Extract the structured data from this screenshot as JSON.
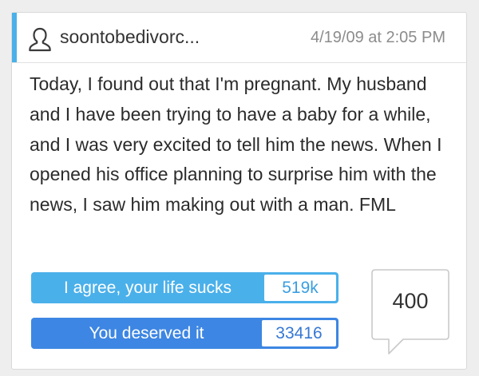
{
  "post": {
    "username": "soontobedivorc...",
    "timestamp": "4/19/09 at 2:05 PM",
    "text": "Today, I found out that I'm pregnant. My husband and I have been trying to have a baby for a while, and I was very excited to tell him the news. When I opened his office planning to surprise him with the news, I saw him making out with a man. FML",
    "user_icon": "user-outline-icon"
  },
  "votes": {
    "agree": {
      "label": "I agree, your life sucks",
      "count": "519k"
    },
    "deserved": {
      "label": "You deserved it",
      "count": "33416"
    }
  },
  "comments": {
    "count": "400",
    "icon": "speech-bubble-icon"
  },
  "colors": {
    "accent": "#4ab0ea",
    "agree_button": "#4ab0ea",
    "deserved_button": "#3d86e3",
    "page_background": "#eeeeee"
  }
}
